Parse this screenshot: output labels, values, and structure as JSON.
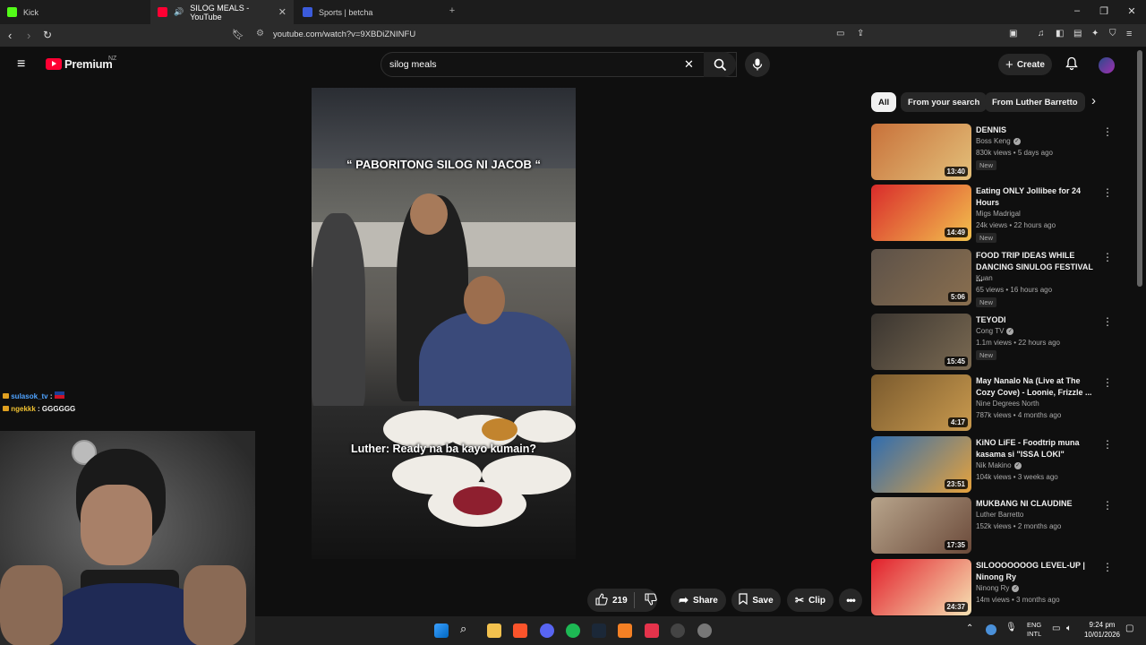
{
  "browser": {
    "tabs": [
      {
        "label": "Kick",
        "color": "#53fc18"
      },
      {
        "label": "SILOG MEALS - YouTube",
        "color": "#ff0033"
      },
      {
        "label": "Sports | betcha",
        "color": "#3b5bdb"
      }
    ],
    "url": "youtube.com/watch?v=9XBDiZNINFU"
  },
  "youtube": {
    "logo_text": "Premium",
    "logo_country": "NZ",
    "search_value": "silog meals",
    "create_label": "Create"
  },
  "video": {
    "caption_top": "“ PABORITONG SILOG NI JACOB “",
    "caption_bottom": "Luther: Ready na ba kayo kumain?",
    "likes": "219",
    "share_label": "Share",
    "save_label": "Save",
    "clip_label": "Clip"
  },
  "chips": [
    "All",
    "From your search",
    "From Luther Barretto"
  ],
  "recommendations": [
    {
      "title": "DENNIS",
      "channel": "Boss Keng",
      "verified": true,
      "meta": "830k views • 5 days ago",
      "new": "New",
      "duration": "13:40",
      "thumb": [
        "#c8713a",
        "#e3c07a"
      ]
    },
    {
      "title": "Eating ONLY Jollibee for 24 Hours",
      "channel": "Migs Madrigal",
      "verified": false,
      "meta": "24k views • 22 hours ago",
      "new": "New",
      "duration": "14:49",
      "thumb": [
        "#d92b2b",
        "#f2c14e"
      ]
    },
    {
      "title": "FOOD TRIP IDEAS WHILE DANCING SINULOG FESTIVAL ...",
      "channel": "Kuan",
      "verified": false,
      "meta": "65 views • 16 hours ago",
      "new": "New",
      "duration": "5:06",
      "thumb": [
        "#5c5148",
        "#8a6f4f"
      ]
    },
    {
      "title": "TEYODI",
      "channel": "Cong TV",
      "verified": true,
      "meta": "1.1m views • 22 hours ago",
      "new": "New",
      "duration": "15:45",
      "thumb": [
        "#3a3530",
        "#7b6a52"
      ]
    },
    {
      "title": "May Nanalo Na (Live at The Cozy Cove) - Loonie, Frizzle ...",
      "channel": "Nine Degrees North",
      "verified": false,
      "meta": "787k views • 4 months ago",
      "new": "",
      "duration": "4:17",
      "thumb": [
        "#7a5a2e",
        "#c99a4e"
      ]
    },
    {
      "title": "KiNO LiFE - Foodtrip muna kasama si \"ISSA LOKI\"",
      "channel": "Nik Makino",
      "verified": true,
      "meta": "104k views • 3 weeks ago",
      "new": "",
      "duration": "23:51",
      "thumb": [
        "#2f6db0",
        "#e6a23c"
      ]
    },
    {
      "title": "MUKBANG NI CLAUDINE",
      "channel": "Luther Barretto",
      "verified": false,
      "meta": "152k views • 2 months ago",
      "new": "",
      "duration": "17:35",
      "thumb": [
        "#b8a58c",
        "#6b4a3a"
      ]
    },
    {
      "title": "SILOOOOOOOG LEVEL-UP | Ninong Ry",
      "channel": "Ninong Ry",
      "verified": true,
      "meta": "14m views • 3 months ago",
      "new": "",
      "duration": "24:37",
      "thumb": [
        "#e21f2b",
        "#f6e3b4"
      ]
    }
  ],
  "chat": [
    {
      "user": "sulasok_tv",
      "text": ":",
      "user_color": "#4fa3ff"
    },
    {
      "user": "ngekkk",
      "text": ": GGGGGG",
      "user_color": "#f1c232"
    }
  ],
  "taskbar": {
    "lang_top": "ENG",
    "lang_bottom": "INTL",
    "time": "9:24 pm",
    "date": "10/01/2026"
  }
}
